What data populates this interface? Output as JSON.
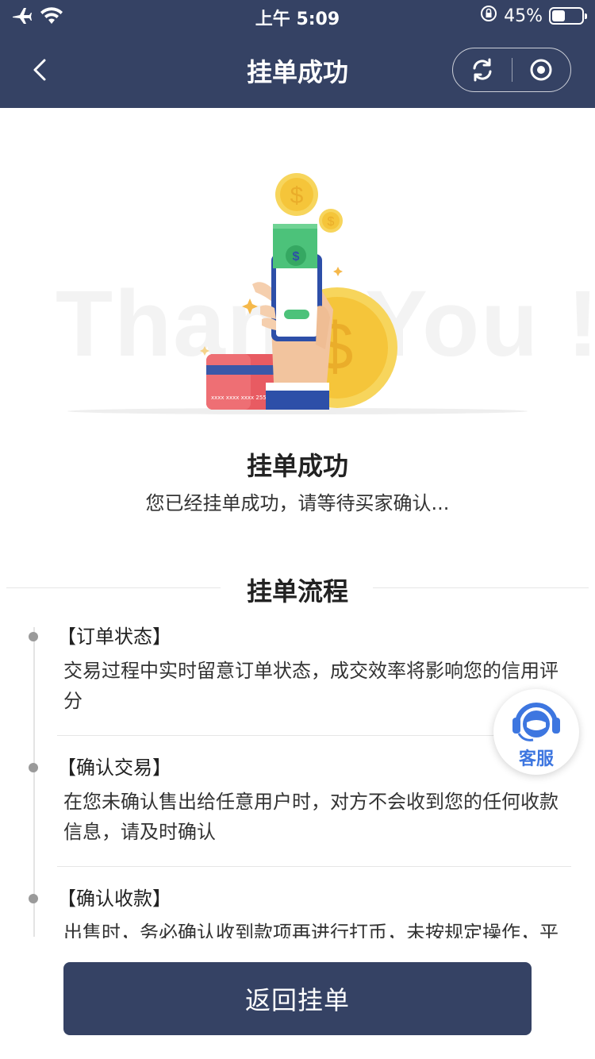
{
  "status_bar": {
    "time": "上午 5:09",
    "battery_percent": "45%",
    "battery_level": 0.45,
    "icons": [
      "airplane-icon",
      "wifi-icon",
      "rotation-lock-icon",
      "battery-icon"
    ]
  },
  "nav": {
    "title": "挂单成功",
    "icons": [
      "back-chevron-icon",
      "refresh-icon",
      "record-icon"
    ]
  },
  "illustration": {
    "watermark_text": "Thank You !",
    "card_number": "xxxx xxxx xxxx 2552",
    "currency_symbol": "$"
  },
  "result": {
    "title": "挂单成功",
    "subtitle": "您已经挂单成功，请等待买家确认..."
  },
  "process": {
    "title": "挂单流程",
    "steps": [
      {
        "title": "【订单状态】",
        "desc": "交易过程中实时留意订单状态，成交效率将影响您的信用评分"
      },
      {
        "title": "【确认交易】",
        "desc": "在您未确认售出给任意用户时，对方不会收到您的任何收款信息，请及时确认"
      },
      {
        "title": "【确认收款】",
        "desc": "出售时，务必确认收到款项再进行打币，未按规定操作，平台不承担相应损失"
      }
    ]
  },
  "customer_service": {
    "label": "客服",
    "icon": "headset-icon"
  },
  "footer": {
    "return_label": "返回挂单"
  },
  "colors": {
    "primary": "#354264",
    "accent_blue": "#3d76e0",
    "coin_yellow": "#f5c53a",
    "bill_green": "#4cc27a",
    "card_red": "#e85b62"
  }
}
